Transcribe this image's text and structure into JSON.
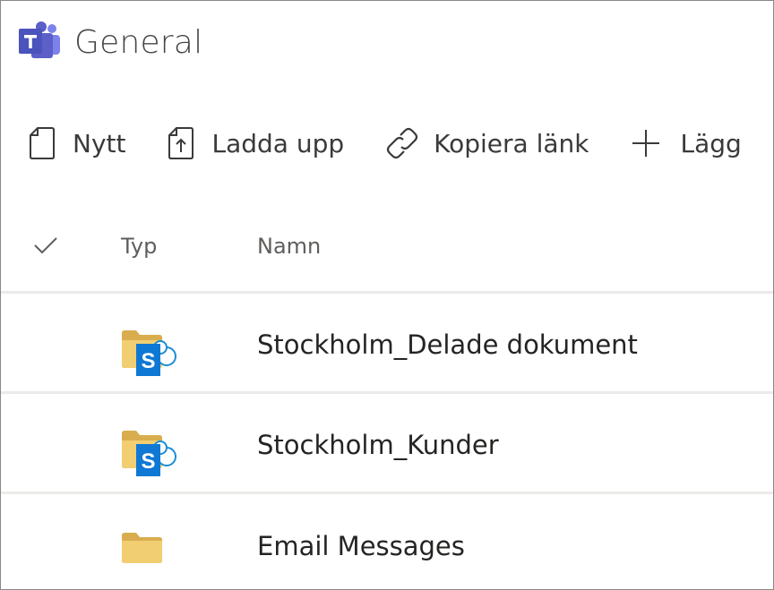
{
  "header": {
    "title": "General"
  },
  "toolbar": {
    "new_label": "Nytt",
    "upload_label": "Ladda upp",
    "copy_link_label": "Kopiera länk",
    "add_label": "Lägg"
  },
  "columns": {
    "type": "Typ",
    "name": "Namn"
  },
  "rows": [
    {
      "name": "Stockholm_Delade dokument",
      "icon": "sharepoint-folder-icon"
    },
    {
      "name": "Stockholm_Kunder",
      "icon": "sharepoint-folder-icon"
    },
    {
      "name": "Email Messages",
      "icon": "folder-icon"
    }
  ],
  "colors": {
    "teams_purple": "#5b5fc7",
    "folder_yellow": "#e8c873",
    "sharepoint_blue": "#0f78d4"
  }
}
